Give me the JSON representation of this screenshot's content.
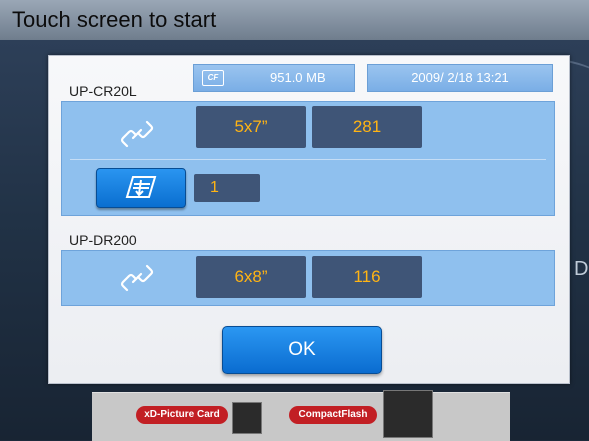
{
  "header": {
    "title": "Touch screen to start"
  },
  "background": {
    "side_text": "D",
    "slots": [
      {
        "label": "xD-Picture Card"
      },
      {
        "label": "CompactFlash"
      }
    ]
  },
  "dialog": {
    "media": {
      "icon": "compactflash-icon",
      "icon_text": "CF",
      "size": "951.0 MB"
    },
    "datetime": "2009/ 2/18 13:21",
    "printers": [
      {
        "name": "UP-CR20L",
        "connection_icon": "link-icon",
        "paper_size": "5x7”",
        "remaining": "281",
        "feed_icon": "paper-feed-icon",
        "feed_count": "1"
      },
      {
        "name": "UP-DR200",
        "connection_icon": "link-icon",
        "paper_size": "6x8”",
        "remaining": "116"
      }
    ],
    "ok_label": "OK"
  },
  "colors": {
    "panel": "#8fc0ee",
    "value_box": "#3f5577",
    "value_text": "#ffb414",
    "button": "#0a6cd0"
  }
}
